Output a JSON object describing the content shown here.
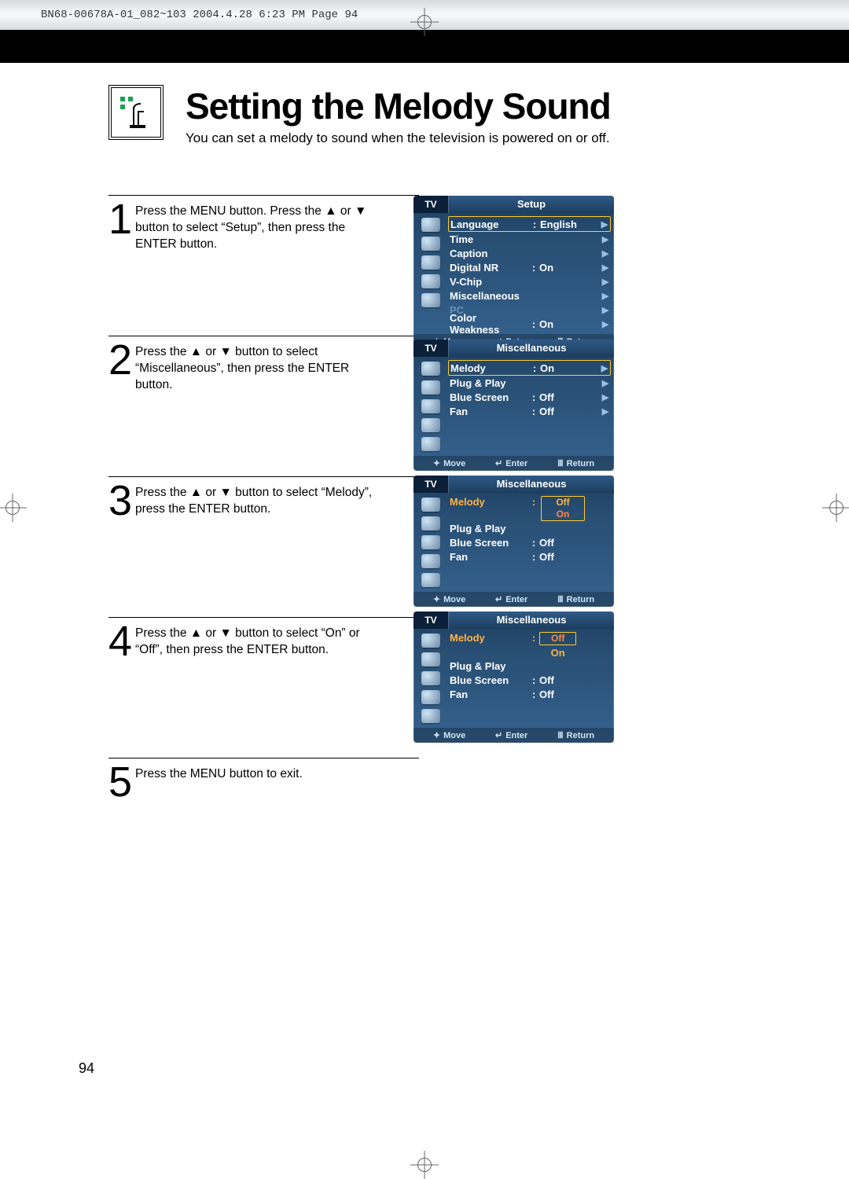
{
  "header_line": "BN68-00678A-01_082~103  2004.4.28  6:23 PM  Page 94",
  "title": "Setting the Melody Sound",
  "subtitle": "You can set a melody to sound when the television is powered on or off.",
  "page_number": "94",
  "steps": {
    "s1": {
      "num": "1",
      "text": "Press the MENU button. Press the ▲ or ▼ button to select “Setup”, then press the ENTER button."
    },
    "s2": {
      "num": "2",
      "text": "Press the ▲ or ▼ button to select “Miscellaneous”, then press the ENTER button."
    },
    "s3": {
      "num": "3",
      "text": "Press the ▲ or ▼ button to select “Melody”, press the ENTER button."
    },
    "s4": {
      "num": "4",
      "text": "Press the ▲ or ▼ button to select “On” or “Off”, then press the ENTER button."
    },
    "s5": {
      "num": "5",
      "text": "Press the MENU button to exit."
    }
  },
  "osd_common": {
    "tv": "TV",
    "foot_move": "Move",
    "foot_enter": "Enter",
    "foot_return": "Return"
  },
  "osd1": {
    "title": "Setup",
    "rows": {
      "r0": {
        "label": "Language",
        "value": "English"
      },
      "r1": {
        "label": "Time"
      },
      "r2": {
        "label": "Caption"
      },
      "r3": {
        "label": "Digital NR",
        "value": "On"
      },
      "r4": {
        "label": "V-Chip"
      },
      "r5": {
        "label": "Miscellaneous"
      },
      "r6": {
        "label": "PC"
      },
      "r7": {
        "label": "Color Weakness",
        "value": "On"
      }
    }
  },
  "osd2": {
    "title": "Miscellaneous",
    "rows": {
      "r0": {
        "label": "Melody",
        "value": "On"
      },
      "r1": {
        "label": "Plug & Play"
      },
      "r2": {
        "label": "Blue Screen",
        "value": "Off"
      },
      "r3": {
        "label": "Fan",
        "value": "Off"
      }
    }
  },
  "osd3": {
    "title": "Miscellaneous",
    "rows": {
      "r0": {
        "label": "Melody"
      },
      "r1": {
        "label": "Plug & Play"
      },
      "r2": {
        "label": "Blue Screen",
        "value": "Off"
      },
      "r3": {
        "label": "Fan",
        "value": "Off"
      }
    },
    "opts": {
      "off": "Off",
      "on": "On"
    }
  },
  "osd4": {
    "title": "Miscellaneous",
    "rows": {
      "r0": {
        "label": "Melody"
      },
      "r1": {
        "label": "Plug & Play"
      },
      "r2": {
        "label": "Blue Screen",
        "value": "Off"
      },
      "r3": {
        "label": "Fan",
        "value": "Off"
      }
    },
    "opts": {
      "off": "Off",
      "on": "On"
    }
  }
}
